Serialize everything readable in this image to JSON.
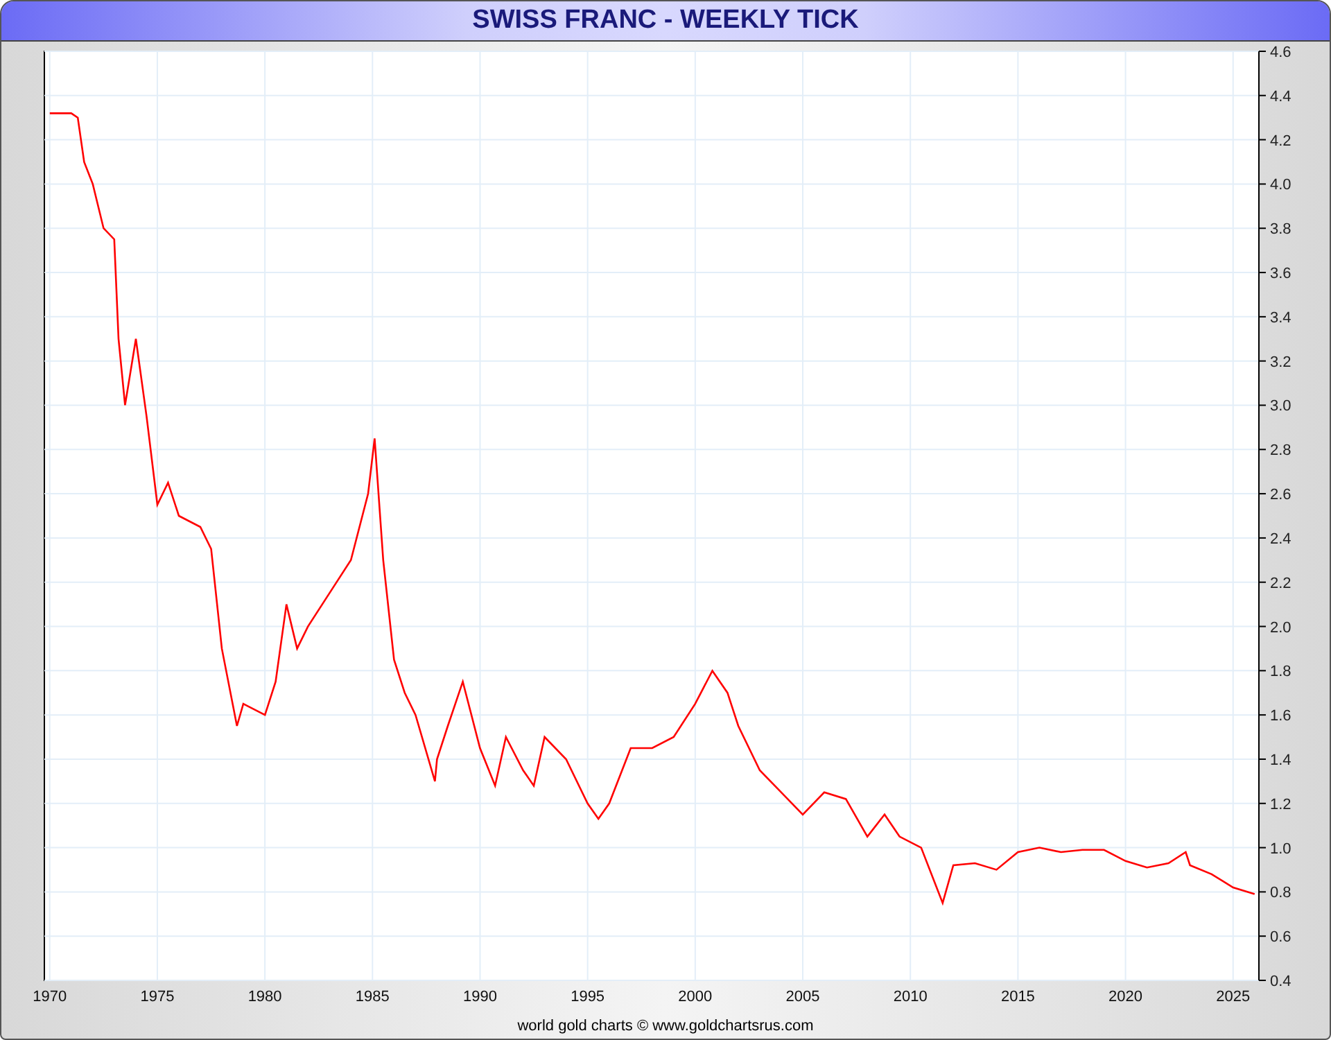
{
  "window": {
    "title": "SWISS FRANC - WEEKLY TICK"
  },
  "chart": {
    "chart_data": {
      "type": "line",
      "x": [
        1970,
        1971,
        1971.3,
        1971.6,
        1972,
        1972.5,
        1973,
        1973.2,
        1973.5,
        1974,
        1974.5,
        1975,
        1975.5,
        1976,
        1977,
        1977.5,
        1978,
        1978.7,
        1979,
        1980,
        1980.5,
        1981,
        1981.5,
        1982,
        1983,
        1984,
        1984.8,
        1985.1,
        1985.5,
        1986,
        1986.5,
        1987,
        1987.9,
        1988,
        1988.5,
        1989.2,
        1990,
        1990.7,
        1991.2,
        1992,
        1992.5,
        1993,
        1994,
        1995,
        1995.5,
        1996,
        1997,
        1998,
        1999,
        2000,
        2000.8,
        2001.5,
        2002,
        2003,
        2004,
        2005,
        2006,
        2007,
        2008,
        2008.8,
        2009.5,
        2010.5,
        2011.5,
        2012,
        2013,
        2014,
        2015,
        2016,
        2017,
        2018,
        2019,
        2020,
        2021,
        2022,
        2022.8,
        2023,
        2024,
        2025,
        2026
      ],
      "grid": true,
      "series": [
        {
          "color": "#ff0000",
          "values": [
            4.32,
            4.32,
            4.3,
            4.1,
            4.0,
            3.8,
            3.75,
            3.3,
            3.0,
            3.3,
            2.95,
            2.55,
            2.65,
            2.5,
            2.45,
            2.35,
            1.9,
            1.55,
            1.65,
            1.6,
            1.75,
            2.1,
            1.9,
            2.0,
            2.15,
            2.3,
            2.6,
            2.85,
            2.3,
            1.85,
            1.7,
            1.6,
            1.3,
            1.4,
            1.55,
            1.75,
            1.45,
            1.28,
            1.5,
            1.35,
            1.28,
            1.5,
            1.4,
            1.2,
            1.13,
            1.2,
            1.45,
            1.45,
            1.5,
            1.65,
            1.8,
            1.7,
            1.55,
            1.35,
            1.25,
            1.15,
            1.25,
            1.22,
            1.05,
            1.15,
            1.05,
            1.0,
            0.75,
            0.92,
            0.93,
            0.9,
            0.98,
            1.0,
            0.98,
            0.99,
            0.99,
            0.94,
            0.91,
            0.93,
            0.98,
            0.92,
            0.88,
            0.82,
            0.79
          ]
        }
      ],
      "xlim": [
        1969.75,
        2026.2
      ],
      "ylim": [
        0.4,
        4.6
      ],
      "xticks": [
        1970,
        1975,
        1980,
        1985,
        1990,
        1995,
        2000,
        2005,
        2010,
        2015,
        2020,
        2025
      ],
      "yticks": [
        {
          "value": 0.4,
          "label": "0.4"
        },
        {
          "value": 0.6,
          "label": "0.6"
        },
        {
          "value": 0.8,
          "label": "0.8"
        },
        {
          "value": 1.0,
          "label": "1.0"
        },
        {
          "value": 1.2,
          "label": "1.2"
        },
        {
          "value": 1.4,
          "label": "1.4"
        },
        {
          "value": 1.6,
          "label": "1.6"
        },
        {
          "value": 1.8,
          "label": "1.8"
        },
        {
          "value": 2.0,
          "label": "2.0"
        },
        {
          "value": 2.2,
          "label": "2.2"
        },
        {
          "value": 2.4,
          "label": "2.4"
        },
        {
          "value": 2.6,
          "label": "2.6"
        },
        {
          "value": 2.8,
          "label": "2.8"
        },
        {
          "value": 3.0,
          "label": "3.0"
        },
        {
          "value": 3.2,
          "label": "3.2"
        },
        {
          "value": 3.4,
          "label": "3.4"
        },
        {
          "value": 3.6,
          "label": "3.6"
        },
        {
          "value": 3.8,
          "label": "3.8"
        },
        {
          "value": 4.0,
          "label": "4.0"
        },
        {
          "value": 4.2,
          "label": "4.2"
        },
        {
          "value": 4.4,
          "label": "4.4"
        },
        {
          "value": 4.6,
          "label": "4.6"
        }
      ]
    }
  },
  "footer": "world gold charts © www.goldchartsrus.com"
}
